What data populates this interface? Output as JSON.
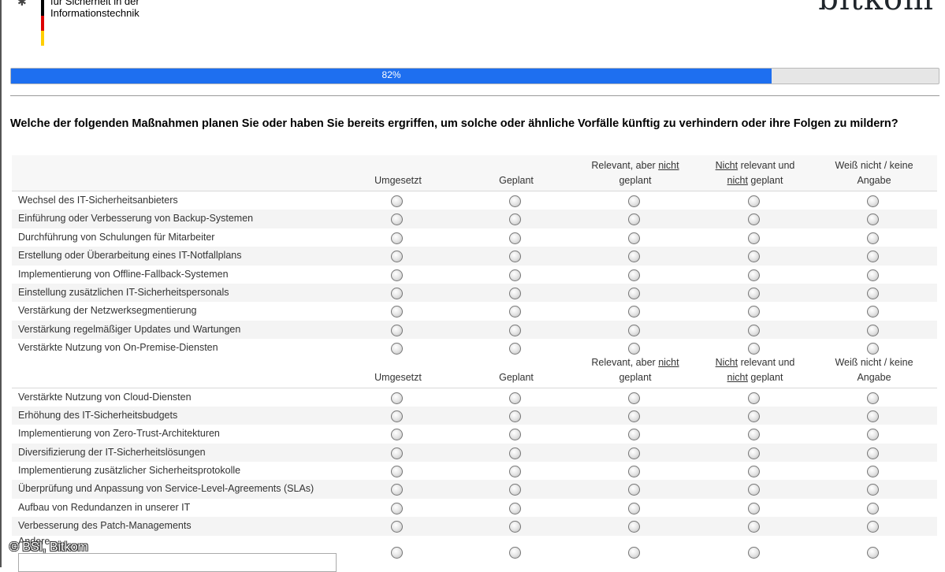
{
  "header": {
    "bsi_line1": "für Sicherheit in der",
    "bsi_line2": "Informationstechnik",
    "bitkom": "bitkom"
  },
  "progress": {
    "value_percent": 82,
    "label": "82%"
  },
  "question": "Welche der folgenden Maßnahmen planen Sie oder haben Sie bereits ergriffen, um solche oder ähnliche Vorfälle künftig zu verhindern oder ihre Folgen zu mildern?",
  "columns": {
    "c1": "Umgesetzt",
    "c2": "Geplant",
    "c3a": "Relevant, aber ",
    "c3b": "nicht",
    "c3c": "geplant",
    "c4a": "Nicht",
    "c4b": " relevant und",
    "c4c": "nicht",
    "c4d": " geplant",
    "c5a": "Weiß nicht / keine",
    "c5b": "Angabe"
  },
  "rows_a": [
    "Wechsel des IT-Sicherheitsanbieters",
    "Einführung oder Verbesserung von Backup-Systemen",
    "Durchführung von Schulungen für Mitarbeiter",
    "Erstellung oder Überarbeitung eines IT-Notfallplans",
    "Implementierung von Offline-Fallback-Systemen",
    "Einstellung zusätzlichen IT-Sicherheitspersonals",
    "Verstärkung der Netzwerksegmentierung",
    "Verstärkung regelmäßiger Updates und Wartungen",
    "Verstärkte Nutzung von On-Premise-Diensten"
  ],
  "rows_b": [
    "Verstärkte Nutzung von Cloud-Diensten",
    "Erhöhung des IT-Sicherheitsbudgets",
    "Implementierung von Zero-Trust-Architekturen",
    "Diversifizierung der IT-Sicherheitslösungen",
    "Implementierung zusätzlicher Sicherheitsprotokolle",
    "Überprüfung und Anpassung von Service-Level-Agreements (SLAs)",
    "Aufbau von Redundanzen in unserer IT",
    "Verbesserung des Patch-Managements"
  ],
  "other": {
    "label": "Andere"
  },
  "copyright": "© BSI, Bitkom",
  "colors": {
    "progress_fill": "#1e6ff0",
    "row_alt": "#f4f4f4"
  }
}
